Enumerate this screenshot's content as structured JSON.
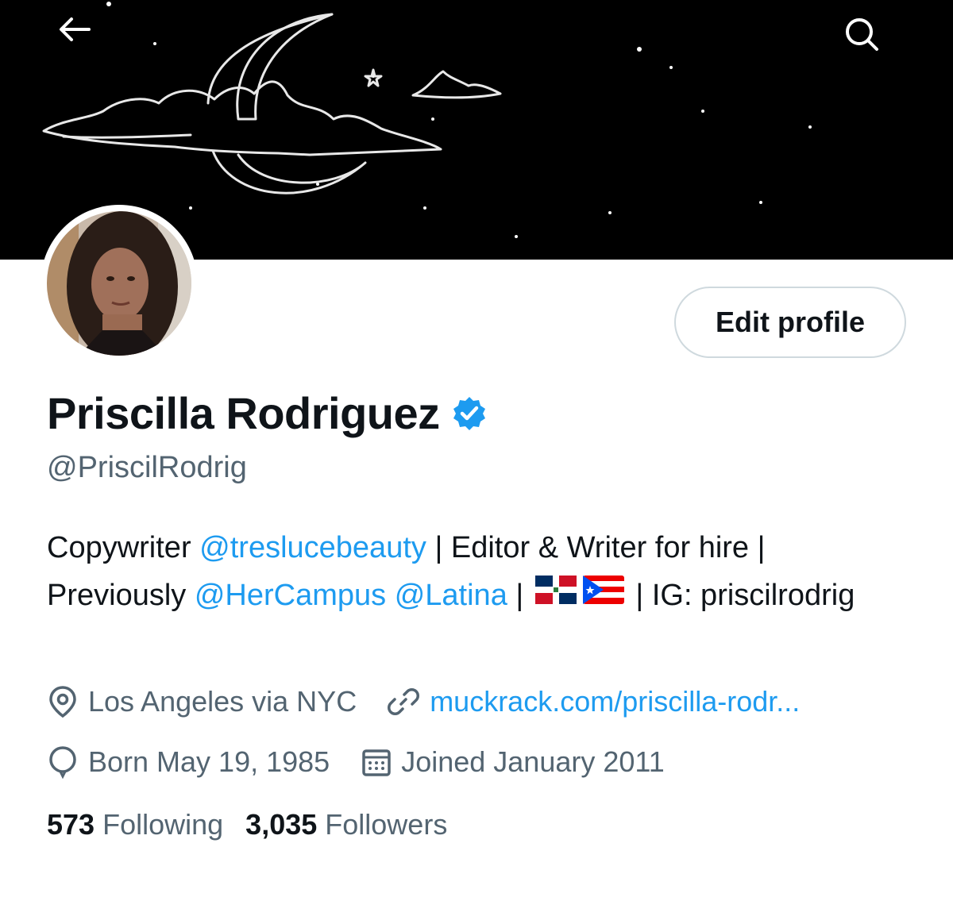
{
  "header": {
    "back_icon": "arrow-left-icon",
    "search_icon": "search-icon"
  },
  "profile": {
    "name": "Priscilla Rodriguez",
    "handle": "@PriscilRodrig",
    "edit_button": "Edit profile",
    "verified": true,
    "bio": {
      "part1": "Copywriter ",
      "mention1": "@treslucebeauty",
      "part2": " | Editor & Writer for hire | Previously ",
      "mention2": "@HerCampus",
      "part3": " ",
      "mention3": "@Latina",
      "part4": " | ",
      "flags": [
        "Dominican Republic flag",
        "Puerto Rico flag"
      ],
      "part5": " | IG: priscilrodrig"
    },
    "location": "Los Angeles via NYC",
    "website": "muckrack.com/priscilla-rodr...",
    "birthday": "Born May 19, 1985",
    "joined": "Joined January 2011",
    "following_count": "573",
    "following_label": "Following",
    "followers_count": "3,035",
    "followers_label": "Followers"
  },
  "colors": {
    "accent": "#1d9bf0",
    "secondary_text": "#536471",
    "primary_text": "#0f1419",
    "banner_bg": "#000000"
  }
}
